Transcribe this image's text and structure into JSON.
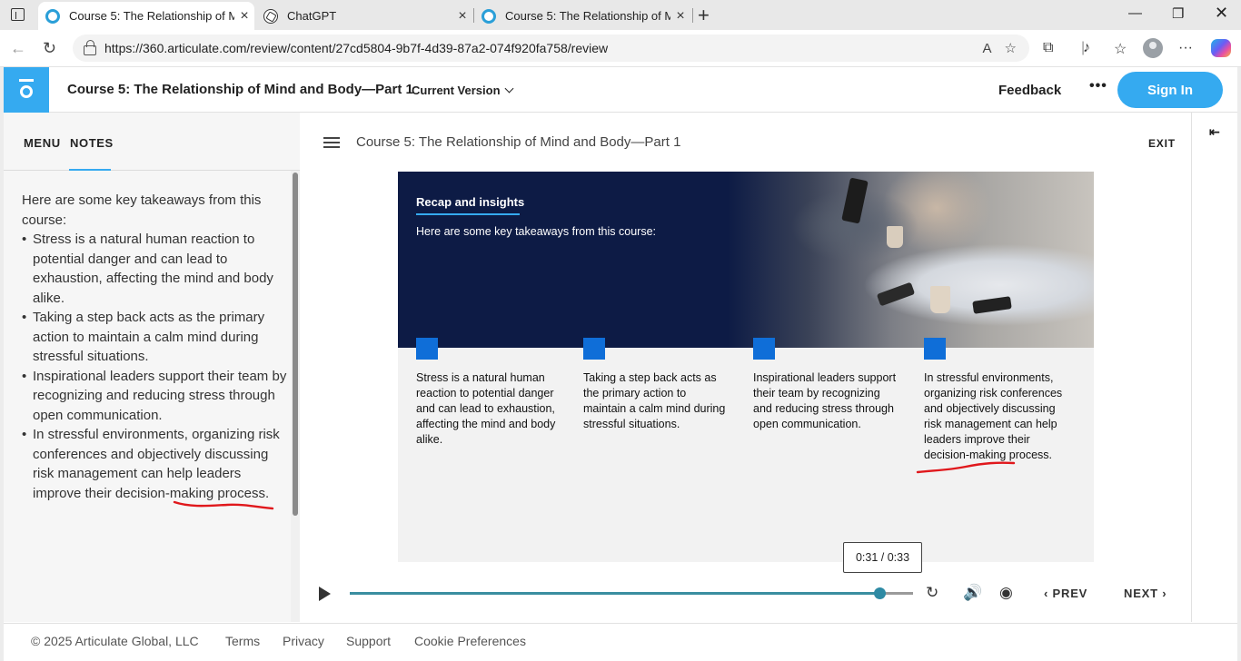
{
  "browser": {
    "tabs": [
      {
        "title": "Course 5: The Relationship of Min",
        "active": true
      },
      {
        "title": "ChatGPT",
        "active": false
      },
      {
        "title": "Course 5: The Relationship of Min",
        "active": false
      }
    ],
    "url": "https://360.articulate.com/review/content/27cd5804-9b7f-4d39-87a2-074f920fa758/review"
  },
  "header": {
    "course_title": "Course 5: The Relationship of Mind and Body—Part 1",
    "version_label": "Current Version",
    "feedback_label": "Feedback",
    "signin_label": "Sign In"
  },
  "left_panel": {
    "tabs": [
      "MENU",
      "NOTES"
    ],
    "active_tab": "NOTES",
    "notes_intro": "Here are some key takeaways from this course:",
    "notes_items": [
      "Stress is a natural human reaction to potential danger and can lead to exhaustion, affecting the mind and body alike.",
      "Taking a step back acts as the primary action to maintain a calm mind during stressful situations.",
      "Inspirational leaders support their team by recognizing and reducing stress through open communication.",
      "In stressful environments, organizing risk conferences and objectively discussing risk management can help leaders improve their decision-making process."
    ]
  },
  "main": {
    "title": "Course 5: The Relationship of Mind and Body—Part 1",
    "exit_label": "EXIT"
  },
  "slide": {
    "heading": "Recap and insights",
    "subheading": "Here are some key takeaways from this course:",
    "columns": [
      "Stress is a natural human reaction to potential danger and can lead to exhaustion, affecting the mind and body alike.",
      "Taking a step back acts as the primary action to maintain a calm mind during stressful situations.",
      "Inspirational leaders support their team by recognizing and reducing stress through open communication.",
      "In stressful environments, organizing risk conferences and objectively discussing risk management can help leaders improve their decision-making process."
    ],
    "accent_color": "#0f6ed8",
    "header_bg": "#0d1b45"
  },
  "player": {
    "time_display": "0:31 / 0:33",
    "progress_fraction": 0.94,
    "prev_label": "PREV",
    "next_label": "NEXT"
  },
  "footer": {
    "copyright": "© 2025 Articulate Global, LLC",
    "links": [
      "Terms",
      "Privacy",
      "Support",
      "Cookie Preferences"
    ]
  },
  "theme": {
    "brand_blue": "#35aaf0"
  }
}
